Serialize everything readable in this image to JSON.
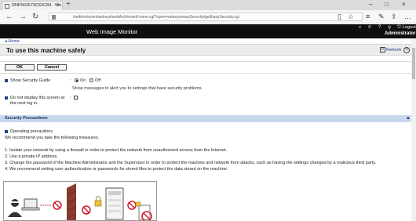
{
  "browser": {
    "tab_title": "RNP002673C62C84 - We",
    "address": "/web/entry/en/websys/webArch/mainFrame.cgi?open=websys/easySecurity/getEasySecurity.cgi"
  },
  "app": {
    "title": "Web Image Monitor",
    "logout": "Logout",
    "user": "Administrator"
  },
  "breadcrumb": "◂ Home",
  "page": {
    "title": "To use this machine safely",
    "refresh": "Refresh",
    "help": "?"
  },
  "buttons": {
    "ok": "OK",
    "cancel": "Cancel"
  },
  "form": {
    "show_guide_label": "Show Security Guide",
    "colon": ":",
    "on_label": "On",
    "off_label": "Off",
    "show_guide_value": "On",
    "show_guide_note": "Show messages to alert you to settings that have security problems.",
    "do_not_display_line1": "Do not display this screen at",
    "do_not_display_line2": "the next log in.",
    "do_not_display_checked": false
  },
  "section": {
    "title": "Security Precautions",
    "operating_label": "Operating precautions",
    "intro": "We recommend you take the following measures.",
    "items": [
      "1. Isolate your network by using a firewall in order to protect the network from unauthorized access from the Internet.",
      "2. Use a private IP address.",
      "3. Change the password of the Machine Administrator and the Supervisor in order to protect the machine and network from attacks, such as having the settings changed by a malicious third party.",
      "4. We recommend setting user authentication or passwords for stored files to protect the data stored on the machine."
    ]
  },
  "colors": {
    "header_bg": "#0f0f0f",
    "section_bg": "#c8d9ee",
    "link": "#1a3a8a",
    "no_symbol": "#d0192b",
    "firewall": "#8b3a2e"
  }
}
